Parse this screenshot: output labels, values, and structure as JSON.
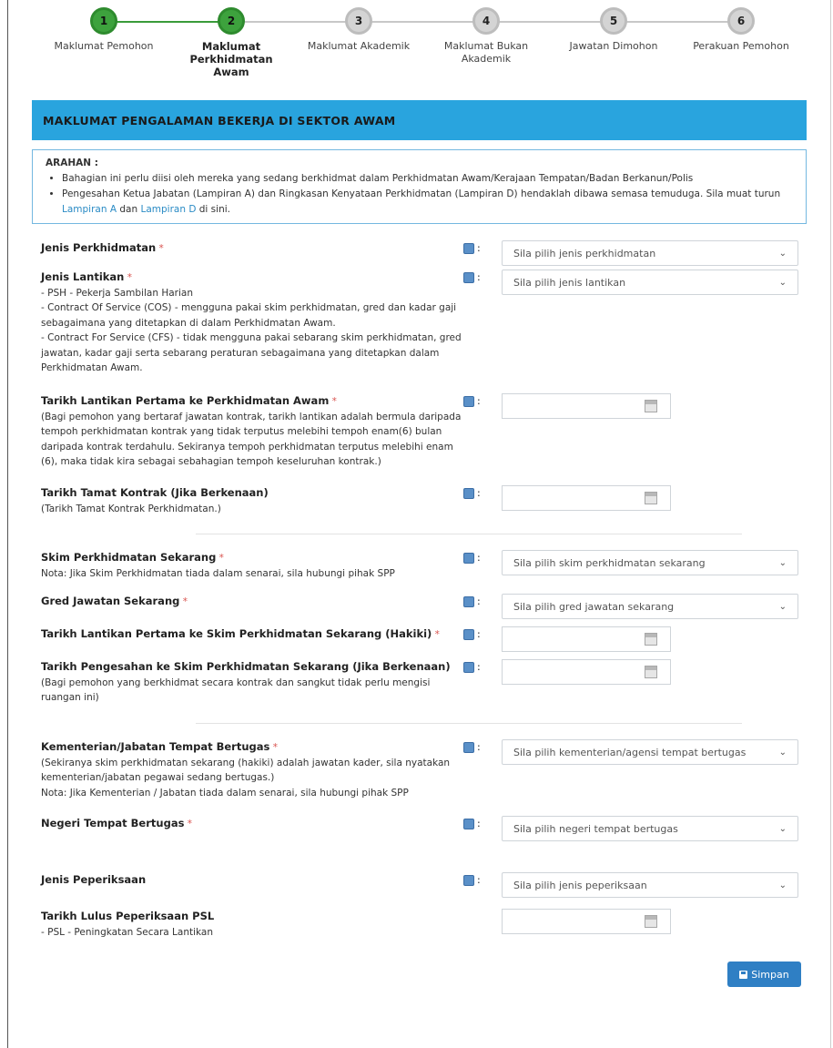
{
  "stepper": {
    "steps": [
      {
        "number": "1",
        "label": "Maklumat Pemohon",
        "state": "done"
      },
      {
        "number": "2",
        "label": "Maklumat Perkhidmatan Awam",
        "state": "active"
      },
      {
        "number": "3",
        "label": "Maklumat Akademik",
        "state": "todo"
      },
      {
        "number": "4",
        "label": "Maklumat Bukan Akademik",
        "state": "todo"
      },
      {
        "number": "5",
        "label": "Jawatan Dimohon",
        "state": "todo"
      },
      {
        "number": "6",
        "label": "Perakuan Pemohon",
        "state": "todo"
      }
    ]
  },
  "section": {
    "title": "MAKLUMAT PENGALAMAN BEKERJA DI SEKTOR AWAM"
  },
  "arahan": {
    "title": "ARAHAN :",
    "bullet1": "Bahagian ini perlu diisi oleh mereka yang sedang berkhidmat dalam Perkhidmatan Awam/Kerajaan Tempatan/Badan Berkanun/Polis",
    "bullet2_text": "Pengesahan Ketua Jabatan (Lampiran A) dan Ringkasan Kenyataan Perkhidmatan (Lampiran D) hendaklah dibawa semasa temuduga. Sila muat turun",
    "link_a": "Lampiran A",
    "and_text": "dan",
    "link_d": "Lampiran D",
    "tail_text": "di sini."
  },
  "form": {
    "jenis_perkhidmatan": {
      "label": "Jenis Perkhidmatan",
      "placeholder": "Sila pilih jenis perkhidmatan"
    },
    "jenis_lantikan": {
      "label": "Jenis Lantikan",
      "notes": [
        "- PSH - Pekerja Sambilan Harian",
        "- Contract Of Service (COS) - mengguna pakai skim perkhidmatan, gred dan kadar gaji sebagaimana yang ditetapkan di dalam Perkhidmatan Awam.",
        "- Contract For Service (CFS) - tidak mengguna pakai sebarang skim perkhidmatan, gred jawatan, kadar gaji serta sebarang peraturan sebagaimana yang ditetapkan dalam Perkhidmatan Awam."
      ],
      "placeholder": "Sila pilih jenis lantikan"
    },
    "tarikh_lantikan_pertama": {
      "label": "Tarikh Lantikan Pertama ke Perkhidmatan Awam",
      "note": "(Bagi pemohon yang bertaraf jawatan kontrak, tarikh lantikan adalah bermula daripada tempoh perkhidmatan kontrak yang tidak terputus melebihi tempoh enam(6) bulan daripada kontrak terdahulu. Sekiranya tempoh perkhidmatan terputus melebihi enam (6), maka tidak kira sebagai sebahagian tempoh keseluruhan kontrak.)"
    },
    "tarikh_tamat_kontrak": {
      "label": "Tarikh Tamat Kontrak (Jika Berkenaan)",
      "note": "(Tarikh Tamat Kontrak Perkhidmatan.)"
    },
    "skim_sekarang": {
      "label": "Skim Perkhidmatan Sekarang",
      "note": "Nota: Jika Skim Perkhidmatan tiada dalam senarai, sila hubungi pihak SPP",
      "placeholder": "Sila pilih skim perkhidmatan sekarang"
    },
    "gred_sekarang": {
      "label": "Gred Jawatan Sekarang",
      "placeholder": "Sila pilih gred jawatan sekarang"
    },
    "tarikh_lantikan_skim": {
      "label": "Tarikh Lantikan Pertama ke Skim Perkhidmatan Sekarang (Hakiki)"
    },
    "tarikh_pengesahan": {
      "label": "Tarikh Pengesahan ke Skim Perkhidmatan Sekarang (Jika Berkenaan)",
      "note": "(Bagi pemohon yang berkhidmat secara kontrak dan sangkut tidak perlu mengisi ruangan ini)"
    },
    "kementerian": {
      "label": "Kementerian/Jabatan Tempat Bertugas",
      "note1": "(Sekiranya skim perkhidmatan sekarang (hakiki) adalah jawatan kader, sila nyatakan kementerian/jabatan pegawai sedang bertugas.)",
      "note2": "Nota: Jika Kementerian / Jabatan tiada dalam senarai, sila hubungi pihak SPP",
      "placeholder": "Sila pilih kementerian/agensi tempat bertugas"
    },
    "negeri": {
      "label": "Negeri Tempat Bertugas",
      "placeholder": "Sila pilih negeri tempat bertugas"
    },
    "jenis_peperiksaan": {
      "label": "Jenis Peperiksaan",
      "placeholder": "Sila pilih jenis peperiksaan"
    },
    "tarikh_lulus_psl": {
      "label": "Tarikh Lulus Peperiksaan PSL",
      "note": "- PSL - Peningkatan Secara Lantikan"
    },
    "required_mark": "*",
    "info_colon": ":"
  },
  "actions": {
    "save_label": "Simpan"
  }
}
